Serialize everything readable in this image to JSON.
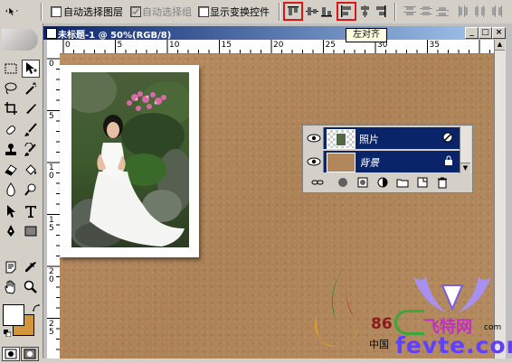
{
  "options": {
    "auto_select_layer": "自动选择图层",
    "auto_select_group": "自动选择组",
    "show_transform": "显示变换控件"
  },
  "document": {
    "title": "未标题-1 @ 50%(RGB/8)",
    "ruler_h": [
      "0",
      "5",
      "10",
      "15",
      "20",
      "25",
      "30",
      "35"
    ],
    "ruler_v": [
      "0",
      "5",
      "1\n0",
      "1\n5",
      "2\n0",
      "2\n5"
    ]
  },
  "tooltip": "左对齐",
  "layers": [
    {
      "name": "照片",
      "italic": false,
      "icon": "fx"
    },
    {
      "name": "背景",
      "italic": true,
      "icon": "lock"
    }
  ],
  "watermark": {
    "num": "86",
    "brand": "飞特网",
    "url": "fevte.com",
    "cn": "中国",
    "suffix": "com"
  },
  "colors": {
    "canvas": "#b3875c",
    "selection": "#0a246a",
    "highlight": "#d81818",
    "foreground": "#ffffff",
    "background": "#d4963a"
  }
}
